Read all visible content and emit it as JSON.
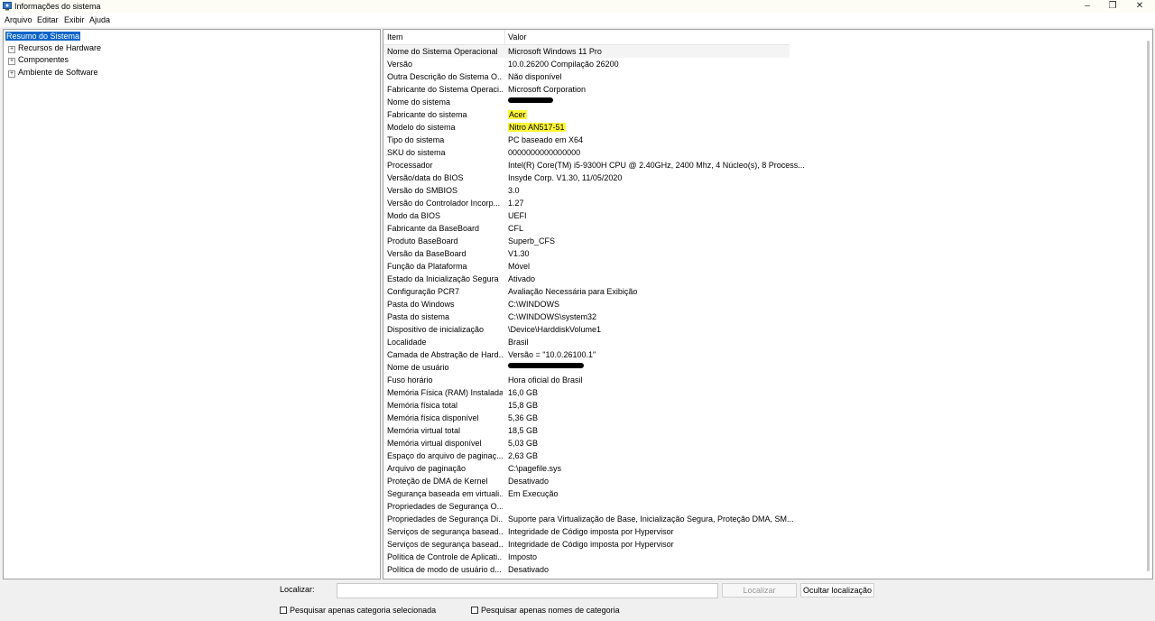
{
  "window": {
    "title": "Informações do sistema"
  },
  "menu": [
    "Arquivo",
    "Editar",
    "Exibir",
    "Ajuda"
  ],
  "tree": [
    {
      "label": "Resumo do Sistema",
      "expandable": false,
      "selected": true
    },
    {
      "label": "Recursos de Hardware",
      "expandable": true
    },
    {
      "label": "Componentes",
      "expandable": true
    },
    {
      "label": "Ambiente de Software",
      "expandable": true
    }
  ],
  "columns": {
    "item": "Item",
    "value": "Valor"
  },
  "rows": [
    {
      "item": "Nome do Sistema Operacional",
      "value": "Microsoft Windows 11 Pro"
    },
    {
      "item": "Versão",
      "value": "10.0.26200 Compilação 26200"
    },
    {
      "item": "Outra Descrição do Sistema O...",
      "value": "Não disponível"
    },
    {
      "item": "Fabricante do Sistema Operaci...",
      "value": "Microsoft Corporation"
    },
    {
      "item": "Nome do sistema",
      "value": "",
      "redacted": true
    },
    {
      "item": "Fabricante do sistema",
      "value": "Acer",
      "highlight": true
    },
    {
      "item": "Modelo do sistema",
      "value": "Nitro AN517-51",
      "highlight": true
    },
    {
      "item": "Tipo do sistema",
      "value": "PC baseado em X64"
    },
    {
      "item": "SKU do sistema",
      "value": "0000000000000000"
    },
    {
      "item": "Processador",
      "value": "Intel(R) Core(TM) i5-9300H CPU @ 2.40GHz, 2400 Mhz, 4 Núcleo(s), 8 Process..."
    },
    {
      "item": "Versão/data do BIOS",
      "value": "Insyde Corp. V1.30, 11/05/2020"
    },
    {
      "item": "Versão do SMBIOS",
      "value": "3.0"
    },
    {
      "item": "Versão do Controlador Incorp...",
      "value": "1.27"
    },
    {
      "item": "Modo da BIOS",
      "value": "UEFI"
    },
    {
      "item": "Fabricante da BaseBoard",
      "value": "CFL"
    },
    {
      "item": "Produto BaseBoard",
      "value": "Superb_CFS"
    },
    {
      "item": "Versão da BaseBoard",
      "value": "V1.30"
    },
    {
      "item": "Função da Plataforma",
      "value": "Móvel"
    },
    {
      "item": "Estado da Inicialização Segura",
      "value": "Ativado"
    },
    {
      "item": "Configuração PCR7",
      "value": "Avaliação Necessária para Exibição"
    },
    {
      "item": "Pasta do Windows",
      "value": "C:\\WINDOWS"
    },
    {
      "item": "Pasta do sistema",
      "value": "C:\\WINDOWS\\system32"
    },
    {
      "item": "Dispositivo de inicialização",
      "value": "\\Device\\HarddiskVolume1"
    },
    {
      "item": "Localidade",
      "value": "Brasil"
    },
    {
      "item": "Camada de Abstração de Hard...",
      "value": "Versão = \"10.0.26100.1\""
    },
    {
      "item": "Nome de usuário",
      "value": "",
      "redacted": true,
      "redact_long": true
    },
    {
      "item": "Fuso horário",
      "value": "Hora oficial do Brasil"
    },
    {
      "item": "Memória Física (RAM) Instalada",
      "value": "16,0 GB"
    },
    {
      "item": "Memória física total",
      "value": "15,8 GB"
    },
    {
      "item": "Memória física disponível",
      "value": "5,36 GB"
    },
    {
      "item": "Memória virtual total",
      "value": "18,5 GB"
    },
    {
      "item": "Memória virtual disponível",
      "value": "5,03 GB"
    },
    {
      "item": "Espaço do arquivo de paginaç...",
      "value": "2,63 GB"
    },
    {
      "item": "Arquivo de paginação",
      "value": "C:\\pagefile.sys"
    },
    {
      "item": "Proteção de DMA de Kernel",
      "value": "Desativado"
    },
    {
      "item": "Segurança baseada em virtuali...",
      "value": "Em Execução"
    },
    {
      "item": "Propriedades de Segurança O...",
      "value": ""
    },
    {
      "item": "Propriedades de Segurança Di...",
      "value": "Suporte para Virtualização de Base, Inicialização Segura, Proteção DMA, SM..."
    },
    {
      "item": "Serviços de segurança basead...",
      "value": "Integridade de Código imposta por Hypervisor"
    },
    {
      "item": "Serviços de segurança basead...",
      "value": "Integridade de Código imposta por Hypervisor"
    },
    {
      "item": "Política de Controle de Aplicati...",
      "value": "Imposto"
    },
    {
      "item": "Política de modo de usuário d...",
      "value": "Desativado"
    }
  ],
  "search": {
    "label": "Localizar:",
    "value": "",
    "find_button": "Localizar",
    "hide_button": "Ocultar localização",
    "check_selected": "Pesquisar apenas categoria selecionada",
    "check_names": "Pesquisar apenas nomes de categoria"
  },
  "colors": {
    "selection": "#0a64c8",
    "highlight": "#fff735"
  }
}
